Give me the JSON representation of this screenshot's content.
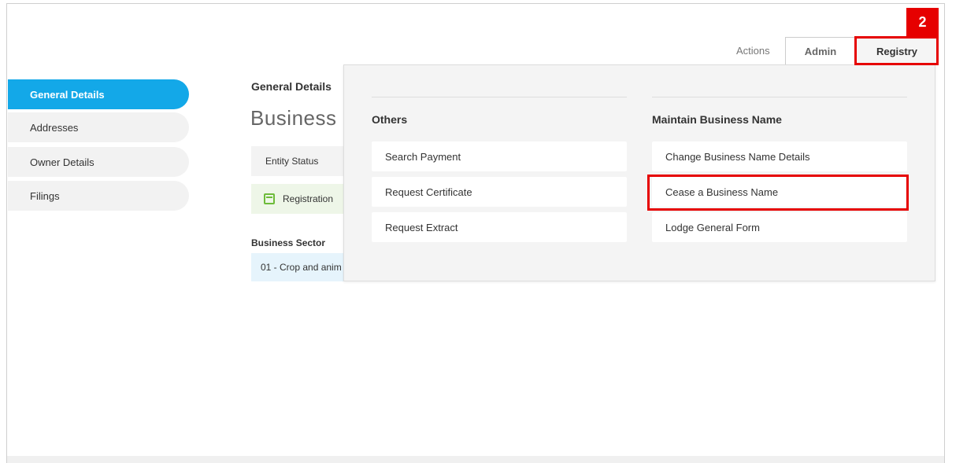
{
  "header": {
    "actions_label": "Actions",
    "tabs": [
      {
        "label": "Admin"
      },
      {
        "label": "Registry"
      }
    ],
    "step_badge": "2"
  },
  "sidebar": {
    "items": [
      {
        "label": "General Details",
        "active": true
      },
      {
        "label": "Addresses"
      },
      {
        "label": "Owner Details"
      },
      {
        "label": "Filings"
      }
    ]
  },
  "main": {
    "section_title": "General Details",
    "entity_name_partial": "Business N",
    "entity_status_label": "Entity Status",
    "registration_partial": "Registration",
    "business_sector_label": "Business Sector",
    "business_sector_value_partial": "01 - Crop and anim"
  },
  "dropdown": {
    "columns": [
      {
        "heading": "Others",
        "items": [
          {
            "label": "Search Payment"
          },
          {
            "label": "Request Certificate"
          },
          {
            "label": "Request Extract"
          }
        ]
      },
      {
        "heading": "Maintain Business Name",
        "items": [
          {
            "label": "Change Business Name Details"
          },
          {
            "label": "Cease a Business Name"
          },
          {
            "label": "Lodge General Form"
          }
        ]
      }
    ]
  },
  "colors": {
    "accent": "#13a8e8",
    "highlight": "#e60000"
  }
}
